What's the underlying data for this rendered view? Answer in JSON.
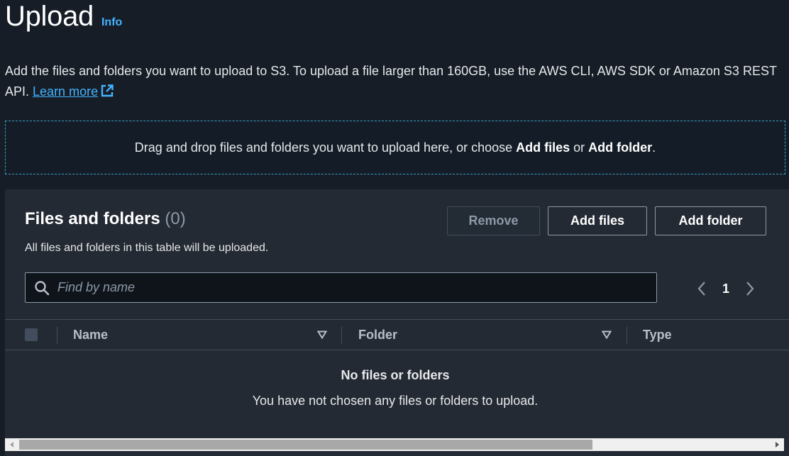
{
  "header": {
    "title": "Upload",
    "info_label": "Info"
  },
  "description": {
    "text": "Add the files and folders you want to upload to S3. To upload a file larger than 160GB, use the AWS CLI, AWS SDK or Amazon S3 REST API.",
    "learn_more": "Learn more"
  },
  "dropzone": {
    "prefix": "Drag and drop files and folders you want to upload here, or choose ",
    "add_files": "Add files",
    "middle": " or ",
    "add_folder": "Add folder",
    "suffix": "."
  },
  "files_panel": {
    "title": "Files and folders",
    "count": "(0)",
    "subtitle": "All files and folders in this table will be uploaded.",
    "remove_label": "Remove",
    "add_files_label": "Add files",
    "add_folder_label": "Add folder",
    "search_placeholder": "Find by name",
    "page_number": "1",
    "columns": [
      "Name",
      "Folder",
      "Type"
    ],
    "empty_title": "No files or folders",
    "empty_message": "You have not chosen any files or folders to upload."
  },
  "colors": {
    "background": "#161d26",
    "panel": "#242a33",
    "link": "#42b4ff",
    "dropzone_border": "#3b9fc9"
  },
  "icons": [
    "external-link-icon",
    "search-icon",
    "chevron-left-icon",
    "chevron-right-icon",
    "sort-down-icon"
  ]
}
